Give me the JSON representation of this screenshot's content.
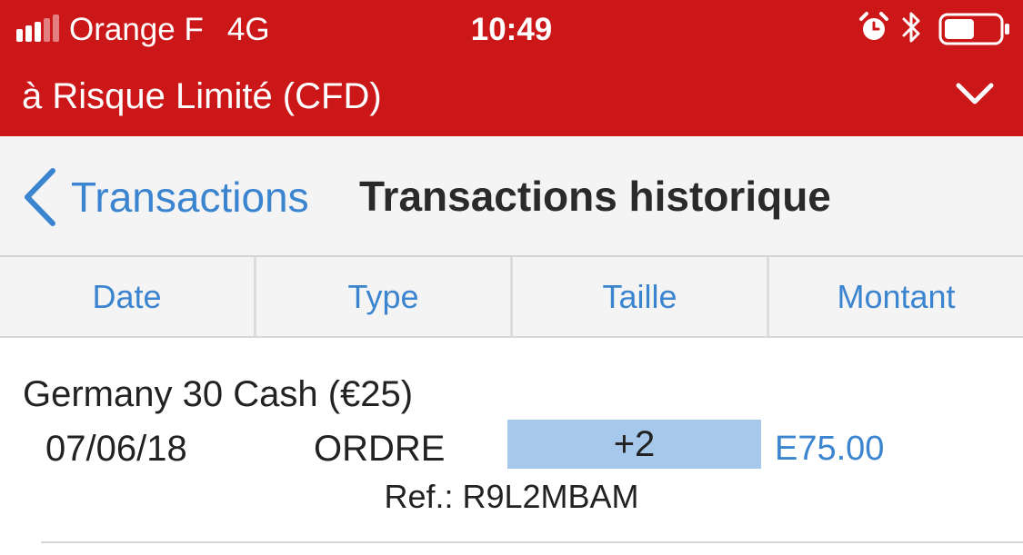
{
  "status_bar": {
    "carrier": "Orange F",
    "network": "4G",
    "time": "10:49",
    "signal_bars_filled": 3,
    "signal_bars_total": 5,
    "icons": [
      "signal-icon",
      "alarm-icon",
      "bluetooth-icon",
      "battery-icon"
    ],
    "battery_level": 0.55
  },
  "header": {
    "account_title": "à Risque Limité (CFD)",
    "expand_icon": "chevron-down-icon",
    "color": "#cc1719"
  },
  "nav": {
    "back_label": "Transactions",
    "title": "Transactions historique",
    "accent": "#3b84cf"
  },
  "columns": [
    "Date",
    "Type",
    "Taille",
    "Montant"
  ],
  "transactions": [
    {
      "instrument": "Germany 30 Cash (€25)",
      "date": "07/06/18",
      "type": "ORDRE",
      "size": "+2",
      "amount": "E75.00",
      "ref": "Ref.: R9L2MBAM"
    }
  ]
}
